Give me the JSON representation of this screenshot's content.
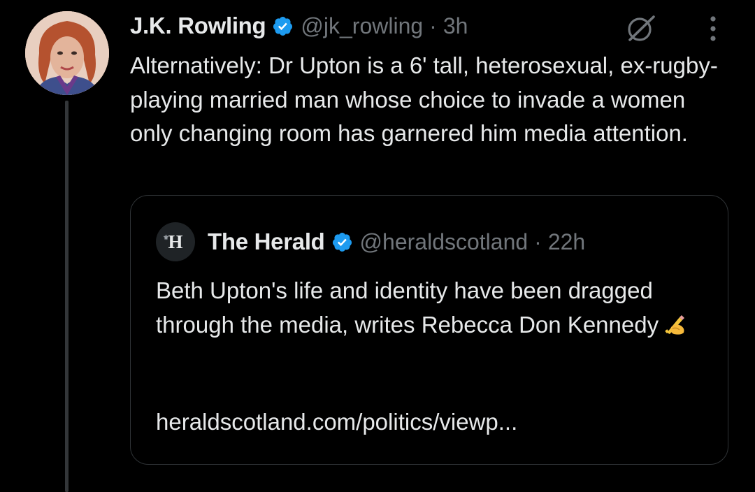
{
  "tweet": {
    "author_name": "J.K. Rowling",
    "handle": "@jk_rowling",
    "separator": "·",
    "time": "3h",
    "verified_icon": "verified-badge-icon",
    "grok_icon": "grok-icon",
    "more_icon": "more-options-icon",
    "text": "Alternatively: Dr Upton is a 6' tall, heterosexual, ex-rugby-playing married man whose choice to invade a women only changing room has garnered him media attention."
  },
  "quote": {
    "avatar_letter": "H",
    "author_name": "The Herald",
    "handle": "@heraldscotland",
    "separator": "·",
    "time": "22h",
    "text": "Beth Upton's life and identity have been dragged through the media, writes Rebecca Don Kennedy",
    "emoji": "writing-hand-emoji",
    "link": "heraldscotland.com/politics/viewp..."
  },
  "colors": {
    "background": "#000000",
    "text_primary": "#e7e9ea",
    "text_secondary": "#71767b",
    "verified_blue": "#1d9bf0",
    "border": "#2f3336"
  }
}
